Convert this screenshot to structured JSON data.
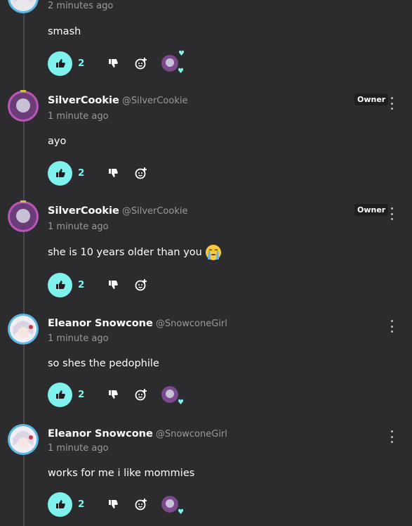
{
  "comments": [
    {
      "username": "",
      "handle": "",
      "time": "2 minutes ago",
      "text": "smash",
      "likes": "2",
      "owner_badge": "",
      "avatar": "eleanor",
      "has_reaction_avatar": true
    },
    {
      "username": "SilverCookie",
      "handle": "@SilverCookie",
      "time": "1 minute ago",
      "text": "ayo",
      "likes": "2",
      "owner_badge": "Owner",
      "avatar": "silver",
      "has_reaction_avatar": false
    },
    {
      "username": "SilverCookie",
      "handle": "@SilverCookie",
      "time": "1 minute ago",
      "text": "she is 10 years older than you",
      "emoji": "loudly-crying-face",
      "likes": "2",
      "owner_badge": "Owner",
      "avatar": "silver",
      "has_reaction_avatar": false
    },
    {
      "username": "Eleanor Snowcone",
      "handle": "@SnowconeGirl",
      "time": "1 minute ago",
      "text": "so shes the pedophile",
      "likes": "2",
      "owner_badge": "",
      "avatar": "eleanor",
      "has_reaction_avatar": true
    },
    {
      "username": "Eleanor Snowcone",
      "handle": "@SnowconeGirl",
      "time": "1 minute ago",
      "text": "works for me i like mommies",
      "likes": "2",
      "owner_badge": "",
      "avatar": "eleanor",
      "has_reaction_avatar": true
    }
  ],
  "icons": {
    "like": "thumbs-up-icon",
    "dislike": "thumbs-down-icon",
    "react": "add-reaction-icon",
    "more": "kebab-menu-icon",
    "heart": "heart-icon"
  },
  "colors": {
    "background": "#2c2b2d",
    "accent": "#7ff2ee",
    "muted_text": "#9a999c"
  }
}
